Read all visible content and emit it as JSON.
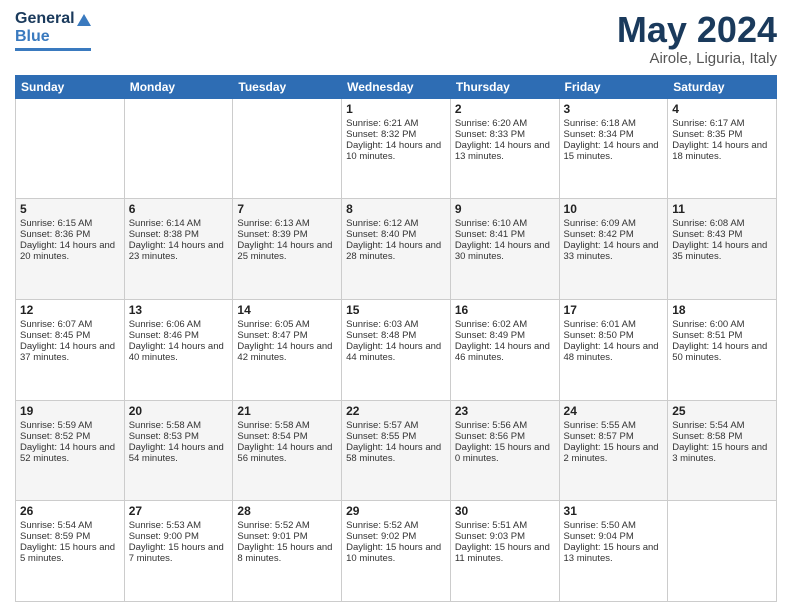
{
  "header": {
    "logo": {
      "general": "General",
      "blue": "Blue"
    },
    "title": "May 2024",
    "location": "Airole, Liguria, Italy"
  },
  "days_of_week": [
    "Sunday",
    "Monday",
    "Tuesday",
    "Wednesday",
    "Thursday",
    "Friday",
    "Saturday"
  ],
  "weeks": [
    [
      {
        "day": "",
        "content": ""
      },
      {
        "day": "",
        "content": ""
      },
      {
        "day": "",
        "content": ""
      },
      {
        "day": "1",
        "content": "Sunrise: 6:21 AM\nSunset: 8:32 PM\nDaylight: 14 hours and 10 minutes."
      },
      {
        "day": "2",
        "content": "Sunrise: 6:20 AM\nSunset: 8:33 PM\nDaylight: 14 hours and 13 minutes."
      },
      {
        "day": "3",
        "content": "Sunrise: 6:18 AM\nSunset: 8:34 PM\nDaylight: 14 hours and 15 minutes."
      },
      {
        "day": "4",
        "content": "Sunrise: 6:17 AM\nSunset: 8:35 PM\nDaylight: 14 hours and 18 minutes."
      }
    ],
    [
      {
        "day": "5",
        "content": "Sunrise: 6:15 AM\nSunset: 8:36 PM\nDaylight: 14 hours and 20 minutes."
      },
      {
        "day": "6",
        "content": "Sunrise: 6:14 AM\nSunset: 8:38 PM\nDaylight: 14 hours and 23 minutes."
      },
      {
        "day": "7",
        "content": "Sunrise: 6:13 AM\nSunset: 8:39 PM\nDaylight: 14 hours and 25 minutes."
      },
      {
        "day": "8",
        "content": "Sunrise: 6:12 AM\nSunset: 8:40 PM\nDaylight: 14 hours and 28 minutes."
      },
      {
        "day": "9",
        "content": "Sunrise: 6:10 AM\nSunset: 8:41 PM\nDaylight: 14 hours and 30 minutes."
      },
      {
        "day": "10",
        "content": "Sunrise: 6:09 AM\nSunset: 8:42 PM\nDaylight: 14 hours and 33 minutes."
      },
      {
        "day": "11",
        "content": "Sunrise: 6:08 AM\nSunset: 8:43 PM\nDaylight: 14 hours and 35 minutes."
      }
    ],
    [
      {
        "day": "12",
        "content": "Sunrise: 6:07 AM\nSunset: 8:45 PM\nDaylight: 14 hours and 37 minutes."
      },
      {
        "day": "13",
        "content": "Sunrise: 6:06 AM\nSunset: 8:46 PM\nDaylight: 14 hours and 40 minutes."
      },
      {
        "day": "14",
        "content": "Sunrise: 6:05 AM\nSunset: 8:47 PM\nDaylight: 14 hours and 42 minutes."
      },
      {
        "day": "15",
        "content": "Sunrise: 6:03 AM\nSunset: 8:48 PM\nDaylight: 14 hours and 44 minutes."
      },
      {
        "day": "16",
        "content": "Sunrise: 6:02 AM\nSunset: 8:49 PM\nDaylight: 14 hours and 46 minutes."
      },
      {
        "day": "17",
        "content": "Sunrise: 6:01 AM\nSunset: 8:50 PM\nDaylight: 14 hours and 48 minutes."
      },
      {
        "day": "18",
        "content": "Sunrise: 6:00 AM\nSunset: 8:51 PM\nDaylight: 14 hours and 50 minutes."
      }
    ],
    [
      {
        "day": "19",
        "content": "Sunrise: 5:59 AM\nSunset: 8:52 PM\nDaylight: 14 hours and 52 minutes."
      },
      {
        "day": "20",
        "content": "Sunrise: 5:58 AM\nSunset: 8:53 PM\nDaylight: 14 hours and 54 minutes."
      },
      {
        "day": "21",
        "content": "Sunrise: 5:58 AM\nSunset: 8:54 PM\nDaylight: 14 hours and 56 minutes."
      },
      {
        "day": "22",
        "content": "Sunrise: 5:57 AM\nSunset: 8:55 PM\nDaylight: 14 hours and 58 minutes."
      },
      {
        "day": "23",
        "content": "Sunrise: 5:56 AM\nSunset: 8:56 PM\nDaylight: 15 hours and 0 minutes."
      },
      {
        "day": "24",
        "content": "Sunrise: 5:55 AM\nSunset: 8:57 PM\nDaylight: 15 hours and 2 minutes."
      },
      {
        "day": "25",
        "content": "Sunrise: 5:54 AM\nSunset: 8:58 PM\nDaylight: 15 hours and 3 minutes."
      }
    ],
    [
      {
        "day": "26",
        "content": "Sunrise: 5:54 AM\nSunset: 8:59 PM\nDaylight: 15 hours and 5 minutes."
      },
      {
        "day": "27",
        "content": "Sunrise: 5:53 AM\nSunset: 9:00 PM\nDaylight: 15 hours and 7 minutes."
      },
      {
        "day": "28",
        "content": "Sunrise: 5:52 AM\nSunset: 9:01 PM\nDaylight: 15 hours and 8 minutes."
      },
      {
        "day": "29",
        "content": "Sunrise: 5:52 AM\nSunset: 9:02 PM\nDaylight: 15 hours and 10 minutes."
      },
      {
        "day": "30",
        "content": "Sunrise: 5:51 AM\nSunset: 9:03 PM\nDaylight: 15 hours and 11 minutes."
      },
      {
        "day": "31",
        "content": "Sunrise: 5:50 AM\nSunset: 9:04 PM\nDaylight: 15 hours and 13 minutes."
      },
      {
        "day": "",
        "content": ""
      }
    ]
  ]
}
